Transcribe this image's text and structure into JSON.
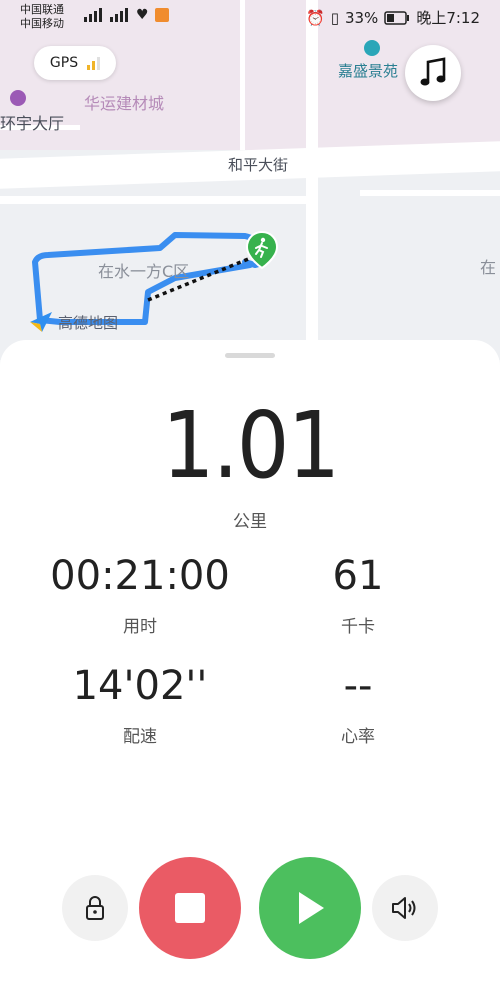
{
  "status_bar": {
    "carrier1": "中国联通",
    "carrier2": "中国移动",
    "battery": "33%",
    "time": "晚上7:12"
  },
  "map": {
    "gps_label": "GPS",
    "labels": {
      "huayun": "华运建材城",
      "huanyu": "环宇大厅",
      "heping": "和平大街",
      "jiasheng": "嘉盛景苑",
      "zaishui": "在水一方C区",
      "amap": "高德地图",
      "right_edge": "在"
    }
  },
  "stats": {
    "distance": "1.01",
    "distance_unit": "公里",
    "duration": "00:21:00",
    "duration_label": "用时",
    "calories": "61",
    "calories_label": "千卡",
    "pace": "14'02''",
    "pace_label": "配速",
    "heart_rate": "--",
    "heart_rate_label": "心率"
  },
  "colors": {
    "route": "#3a8ef0",
    "stop": "#ea5b65",
    "play": "#4cbf5e",
    "start_marker": "#37b24d"
  }
}
